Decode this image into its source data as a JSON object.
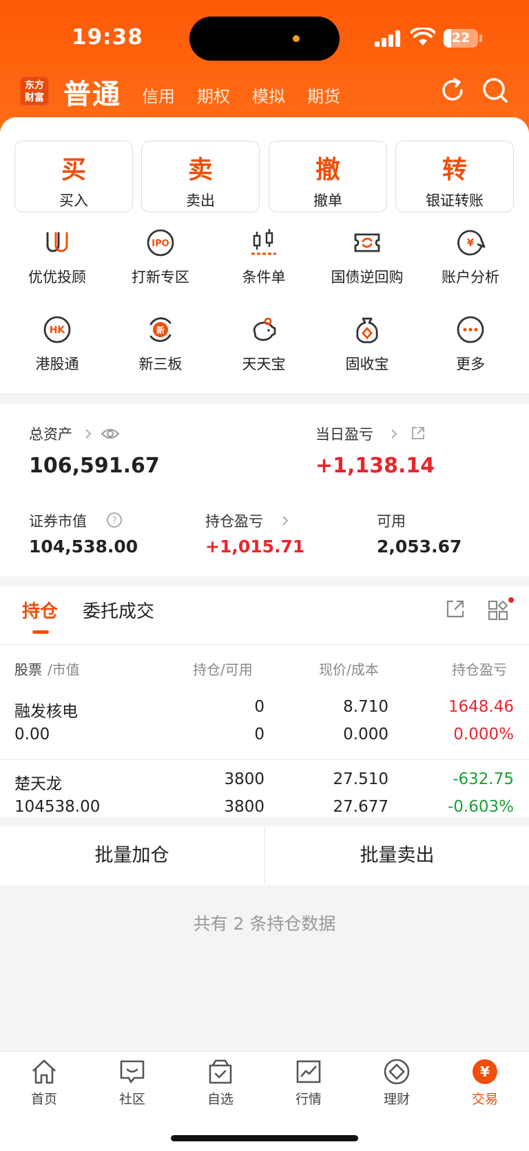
{
  "status": {
    "time": "19:38",
    "battery": "22",
    "battery_level": 0.22
  },
  "nav": {
    "logo_line1": "东方",
    "logo_line2": "财富",
    "main": "普通",
    "tabs": [
      "信用",
      "期权",
      "模拟",
      "期货"
    ]
  },
  "quick": [
    {
      "big": "买",
      "small": "买入"
    },
    {
      "big": "卖",
      "small": "卖出"
    },
    {
      "big": "撤",
      "small": "撤单"
    },
    {
      "big": "转",
      "small": "银证转账"
    }
  ],
  "features": [
    {
      "label": "优优投顾",
      "icon": "uu-advisor-icon"
    },
    {
      "label": "打新专区",
      "icon": "ipo-icon"
    },
    {
      "label": "条件单",
      "icon": "candlestick-icon"
    },
    {
      "label": "国债逆回购",
      "icon": "repo-icon"
    },
    {
      "label": "账户分析",
      "icon": "account-analysis-icon"
    },
    {
      "label": "港股通",
      "icon": "hk-icon"
    },
    {
      "label": "新三板",
      "icon": "new-third-board-icon"
    },
    {
      "label": "天天宝",
      "icon": "piggy-bank-icon"
    },
    {
      "label": "固收宝",
      "icon": "money-bag-icon"
    },
    {
      "label": "更多",
      "icon": "more-icon"
    }
  ],
  "assets": {
    "total_label": "总资产",
    "total_value": "106,591.67",
    "daily_label": "当日盈亏",
    "daily_value": "+1,138.14",
    "market_label": "证券市值",
    "market_value": "104,538.00",
    "holding_label": "持仓盈亏",
    "holding_value": "+1,015.71",
    "available_label": "可用",
    "available_value": "2,053.67"
  },
  "positions": {
    "tabs": [
      "持仓",
      "委托成交"
    ],
    "headers": {
      "stock": "股票",
      "stock_sub": "/市值",
      "hold": "持仓/可用",
      "price": "现价/成本",
      "pnl": "持仓盈亏"
    },
    "rows": [
      {
        "name": "融发核电",
        "value": "0.00",
        "hold": "0",
        "avail": "0",
        "price": "8.710",
        "cost": "0.000",
        "pnl": "1648.46",
        "pnl_pct": "0.000%",
        "color": "red"
      },
      {
        "name": "楚天龙",
        "value": "104538.00",
        "hold": "3800",
        "avail": "3800",
        "price": "27.510",
        "cost": "27.677",
        "pnl": "-632.75",
        "pnl_pct": "-0.603%",
        "color": "green"
      }
    ],
    "batch_add": "批量加仓",
    "batch_sell": "批量卖出",
    "summary": "共有 2 条持仓数据"
  },
  "tabbar": [
    {
      "label": "首页",
      "icon": "home-icon"
    },
    {
      "label": "社区",
      "icon": "community-icon"
    },
    {
      "label": "自选",
      "icon": "watchlist-icon"
    },
    {
      "label": "行情",
      "icon": "market-icon"
    },
    {
      "label": "理财",
      "icon": "wealth-icon"
    },
    {
      "label": "交易",
      "icon": "trade-icon"
    }
  ],
  "colors": {
    "accent": "#f04e0a",
    "up": "#e8252d",
    "down": "#1aa037"
  }
}
